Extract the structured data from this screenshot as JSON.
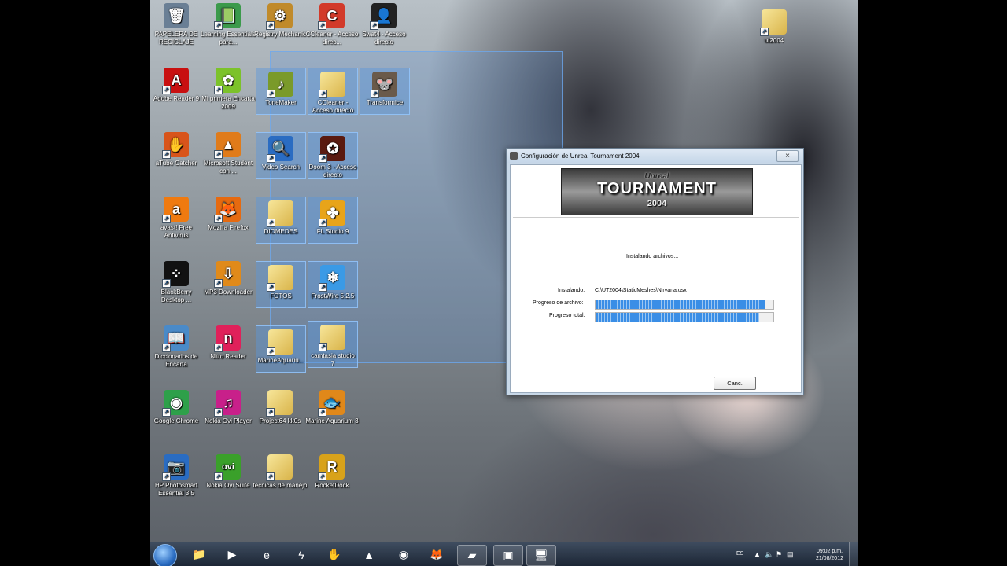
{
  "desktop": {
    "icons": [
      {
        "label": "PAPELERA DE RECICLAJE",
        "icon": "recycle-bin-icon",
        "glyph": "🗑",
        "color": "#6a7f95"
      },
      {
        "label": "Learning Essentials para...",
        "icon": "learning-essentials-icon",
        "glyph": "📗",
        "color": "#3b9a4b"
      },
      {
        "label": "Registry Mechanic",
        "icon": "registry-mechanic-icon",
        "glyph": "⚙",
        "color": "#c08a2a"
      },
      {
        "label": "CCleaner - Acceso direc...",
        "icon": "ccleaner-icon",
        "glyph": "C",
        "color": "#d23a2a"
      },
      {
        "label": "Swat4 - Acceso directo",
        "icon": "swat4-icon",
        "glyph": "👤",
        "color": "#222222"
      },
      {
        "label": "Adobe Reader 9",
        "icon": "adobe-reader-icon",
        "glyph": "A",
        "color": "#c81010"
      },
      {
        "label": "Mi primera Encarta 2009",
        "icon": "encarta-icon",
        "glyph": "✿",
        "color": "#7cc22a"
      },
      {
        "label": "ToneMaker",
        "icon": "tonemaker-icon",
        "glyph": "♪",
        "color": "#7a9a2a"
      },
      {
        "label": "CCleaner - Acceso directo",
        "icon": "folder-icon",
        "glyph": "",
        "color": ""
      },
      {
        "label": "Transformice",
        "icon": "transformice-icon",
        "glyph": "🐭",
        "color": "#6a5a4a"
      },
      {
        "label": "aTube Catcher",
        "icon": "atube-catcher-icon",
        "glyph": "✋",
        "color": "#d8541a"
      },
      {
        "label": "Microsoft Student con ...",
        "icon": "ms-student-icon",
        "glyph": "▲",
        "color": "#e07b1a"
      },
      {
        "label": "Video Search",
        "icon": "video-search-icon",
        "glyph": "🔍",
        "color": "#2a6cc2"
      },
      {
        "label": "Doom 3 - Acceso directo",
        "icon": "doom3-icon",
        "glyph": "✪",
        "color": "#5a1a10"
      },
      {
        "label": "avast! Free Antivirus",
        "icon": "avast-icon",
        "glyph": "a",
        "color": "#ef7a10"
      },
      {
        "label": "Mozilla Firefox",
        "icon": "firefox-icon",
        "glyph": "🦊",
        "color": "#e66a10"
      },
      {
        "label": "DIOMEDES",
        "icon": "folder-icon",
        "glyph": "",
        "color": ""
      },
      {
        "label": "FL Studio 9",
        "icon": "fl-studio-icon",
        "glyph": "✤",
        "color": "#e8a41a"
      },
      {
        "label": "BlackBerry Desktop ...",
        "icon": "blackberry-icon",
        "glyph": "⁘",
        "color": "#111111"
      },
      {
        "label": "MP3 Downloader",
        "icon": "mp3-downloader-icon",
        "glyph": "⇩",
        "color": "#e08a1a"
      },
      {
        "label": "FOTOS",
        "icon": "folder-icon",
        "glyph": "",
        "color": ""
      },
      {
        "label": "FrostWire 5.2.5",
        "icon": "frostwire-icon",
        "glyph": "❄",
        "color": "#3a9ae6"
      },
      {
        "label": "Diccionarios de Encarta",
        "icon": "diccionarios-icon",
        "glyph": "📖",
        "color": "#4a8ac8"
      },
      {
        "label": "Nitro Reader",
        "icon": "nitro-reader-icon",
        "glyph": "n",
        "color": "#e0205a"
      },
      {
        "label": "MarineAquariu...",
        "icon": "folder-icon",
        "glyph": "",
        "color": ""
      },
      {
        "label": "camtasia studio 7",
        "icon": "folder-icon",
        "glyph": "",
        "color": ""
      },
      {
        "label": "Google Chrome",
        "icon": "chrome-icon",
        "glyph": "◉",
        "color": "#2ea04a"
      },
      {
        "label": "Nokia Ovi Player",
        "icon": "nokia-ovi-player-icon",
        "glyph": "♫",
        "color": "#c8208a"
      },
      {
        "label": "Project64 kk0s",
        "icon": "folder-icon",
        "glyph": "",
        "color": ""
      },
      {
        "label": "Marine Aquarium 3",
        "icon": "marine-aquarium-icon",
        "glyph": "🐟",
        "color": "#e0881a"
      },
      {
        "label": "HP Photosmart Essential 3.5",
        "icon": "hp-photosmart-icon",
        "glyph": "📷",
        "color": "#2a6cc2"
      },
      {
        "label": "Nokia Ovi Suite",
        "icon": "nokia-ovi-suite-icon",
        "glyph": "ovi",
        "color": "#3aa02a"
      },
      {
        "label": "tecnicas de manejo",
        "icon": "folder-icon",
        "glyph": "",
        "color": ""
      },
      {
        "label": "RocketDock",
        "icon": "rocketdock-icon",
        "glyph": "R",
        "color": "#d8a21a"
      },
      {
        "label": "ut2004",
        "icon": "folder-icon",
        "glyph": "",
        "color": ""
      }
    ]
  },
  "dialog": {
    "title": "Configuración de Unreal Tournament 2004",
    "close_glyph": "×",
    "banner": {
      "line1": "Unreal",
      "line2": "TOURNAMENT",
      "line3": "2004"
    },
    "status": "Instalando archivos...",
    "installing_label": "Instalando:",
    "installing_path": "C:\\UT2004\\StaticMeshes\\Nirvana.usx",
    "file_progress_label": "Progreso de archivo:",
    "file_progress": 0.95,
    "total_progress_label": "Progreso total:",
    "total_progress": 0.92,
    "cancel_label": "Canc."
  },
  "taskbar": {
    "items": [
      {
        "icon": "explorer-icon",
        "glyph": "📁"
      },
      {
        "icon": "media-player-icon",
        "glyph": "▶"
      },
      {
        "icon": "internet-explorer-icon",
        "glyph": "e"
      },
      {
        "icon": "lightning-app-icon",
        "glyph": "ϟ"
      },
      {
        "icon": "atube-catcher-icon",
        "glyph": "✋"
      },
      {
        "icon": "ms-student-icon",
        "glyph": "▲"
      },
      {
        "icon": "chrome-icon",
        "glyph": "◉"
      },
      {
        "icon": "firefox-icon",
        "glyph": "🦊"
      },
      {
        "icon": "notes-app-icon",
        "glyph": "▰"
      },
      {
        "icon": "installer-app-icon",
        "glyph": "▣"
      },
      {
        "icon": "setup-app-icon",
        "glyph": "🖥"
      }
    ],
    "lang": "ES",
    "time": "09:02 p.m.",
    "date": "21/08/2012"
  }
}
